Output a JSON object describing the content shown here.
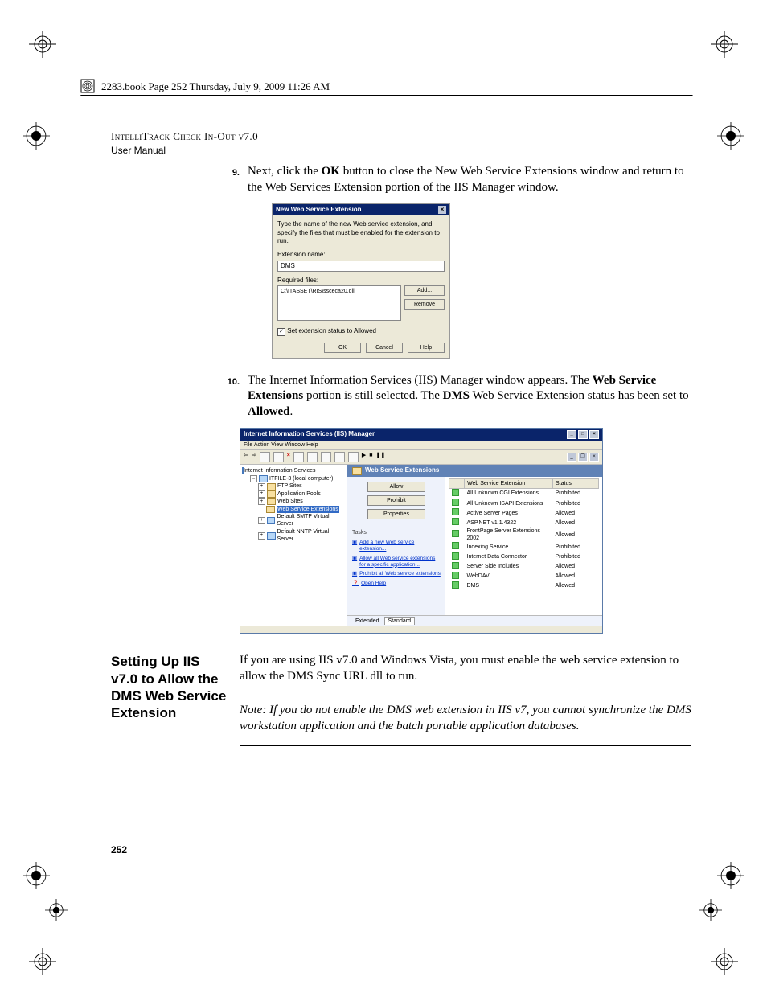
{
  "header": {
    "bookline": "2283.book  Page 252  Thursday, July 9, 2009  11:26 AM"
  },
  "doc": {
    "product_line": "IntelliTrack Check In-Out v7.0",
    "subtitle": "User Manual",
    "page_number": "252"
  },
  "steps": {
    "s9": {
      "num": "9.",
      "text_pre": "Next, click the ",
      "bold1": "OK",
      "text_post": " button to close the New Web Service Extensions window and return to the Web Services Extension portion of the IIS Manager window."
    },
    "s10": {
      "num": "10.",
      "text1": "The Internet Information Services (IIS) Manager window appears. The ",
      "bold1": "Web Service Extensions",
      "text2": " portion is still selected. The ",
      "bold2": "DMS",
      "text3": " Web Service Extension status has been set to ",
      "bold3": "Allowed",
      "text4": "."
    }
  },
  "dialog1": {
    "title": "New Web Service Extension",
    "close": "×",
    "desc": "Type the name of the new Web service extension, and specify the files that must be enabled for the extension to run.",
    "ext_label": "Extension name:",
    "ext_value": "DMS",
    "req_label": "Required files:",
    "req_value": "C:\\ITASSET\\RIS\\ssceca20.dll",
    "btn_add": "Add...",
    "btn_remove": "Remove",
    "checkbox": "Set extension status to Allowed",
    "btn_ok": "OK",
    "btn_cancel": "Cancel",
    "btn_help": "Help"
  },
  "iis": {
    "title": "Internet Information Services (IIS) Manager",
    "menu": "File   Action   View   Window   Help",
    "tree": {
      "root": "Internet Information Services",
      "host": "ITFILE-3 (local computer)",
      "n1": "FTP Sites",
      "n2": "Application Pools",
      "n3": "Web Sites",
      "n4": "Web Service Extensions",
      "n5": "Default SMTP Virtual Server",
      "n6": "Default NNTP Virtual Server"
    },
    "panel_title": "Web Service Extensions",
    "btn_allow": "Allow",
    "btn_prohibit": "Prohibit",
    "btn_properties": "Properties",
    "tasks_label": "Tasks",
    "link1": "Add a new Web service extension...",
    "link2": "Allow all Web service extensions for a specific application...",
    "link3": "Prohibit all Web service extensions",
    "link4": "Open Help",
    "col1": "Web Service Extension",
    "col2": "Status",
    "rows": [
      {
        "name": "All Unknown CGI Extensions",
        "status": "Prohibited"
      },
      {
        "name": "All Unknown ISAPI Extensions",
        "status": "Prohibited"
      },
      {
        "name": "Active Server Pages",
        "status": "Allowed"
      },
      {
        "name": "ASP.NET v1.1.4322",
        "status": "Allowed"
      },
      {
        "name": "FrontPage Server Extensions 2002",
        "status": "Allowed"
      },
      {
        "name": "Indexing Service",
        "status": "Prohibited"
      },
      {
        "name": "Internet Data Connector",
        "status": "Prohibited"
      },
      {
        "name": "Server Side Includes",
        "status": "Allowed"
      },
      {
        "name": "WebDAV",
        "status": "Allowed"
      },
      {
        "name": "DMS",
        "status": "Allowed"
      }
    ],
    "tab1": "Extended",
    "tab2": "Standard"
  },
  "section": {
    "title": "Setting Up IIS v7.0 to Allow the DMS Web Service Extension",
    "body": "If you are using IIS v7.0 and Windows Vista, you must enable the web service extension to allow the DMS Sync URL dll to run.",
    "note_label": "Note:  ",
    "note_body": "If you do not enable the DMS web extension in IIS v7, you cannot synchronize the DMS workstation application and the batch portable application databases."
  }
}
